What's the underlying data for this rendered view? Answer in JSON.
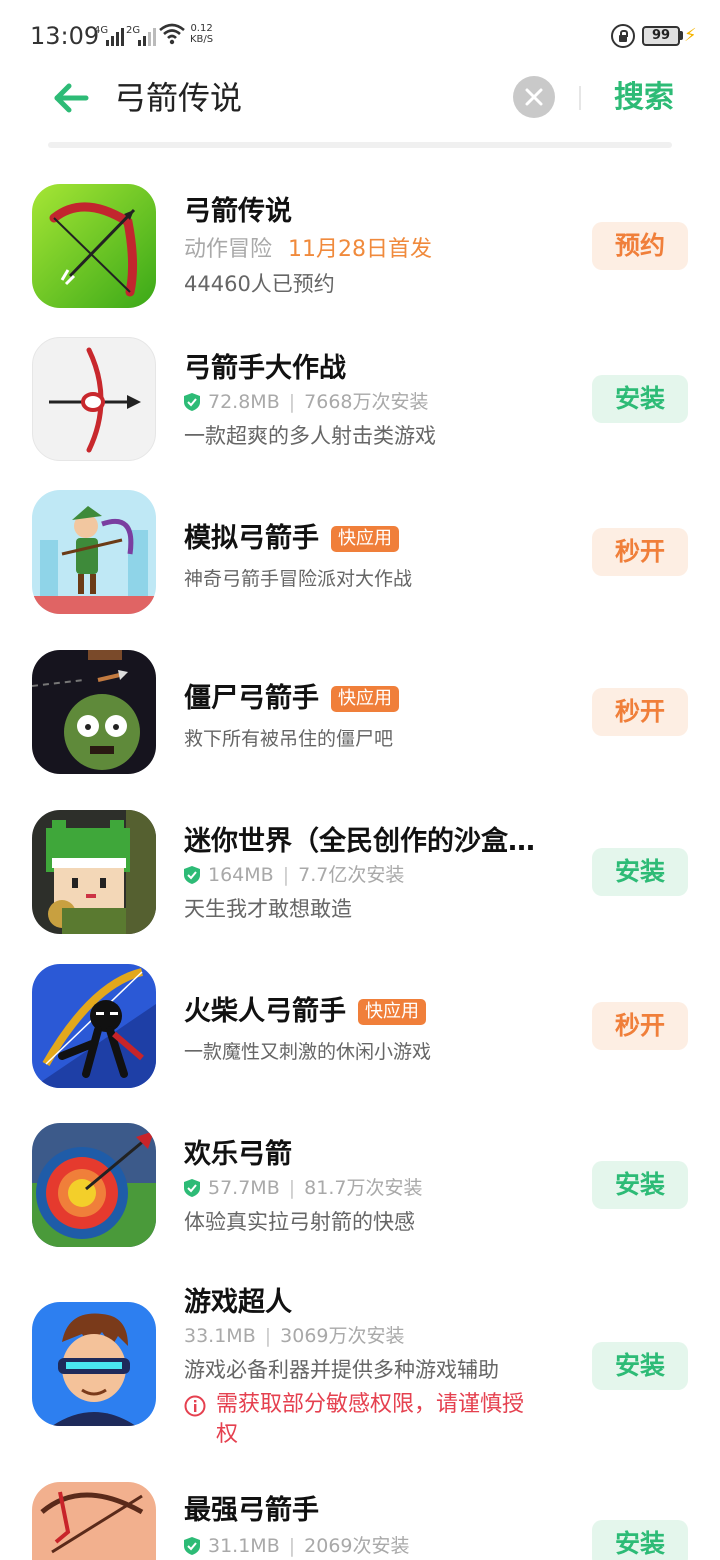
{
  "status_bar": {
    "time": "13:09",
    "sim1_label": "4G",
    "sim2_label": "2G",
    "net_speed_value": "0.12",
    "net_speed_unit": "KB/S",
    "battery": "99",
    "colors": {
      "text": "#333333",
      "charging": "#f5b400"
    }
  },
  "search": {
    "query": "弓箭传说",
    "search_button_label": "搜索",
    "icons": {
      "back": "arrow-left-icon",
      "clear": "close-circle-icon"
    },
    "colors": {
      "accent": "#2dbb76"
    }
  },
  "results": [
    {
      "name": "弓箭传说",
      "genre": "动作冒险",
      "release": "11月28日首发",
      "desc": "44460人已预约",
      "button": "预约",
      "button_style": "orange"
    },
    {
      "name": "弓箭手大作战",
      "size": "72.8MB",
      "installs": "7668万次安装",
      "desc": "一款超爽的多人射击类游戏",
      "button": "安装",
      "button_style": "green"
    },
    {
      "name": "模拟弓箭手",
      "badge": "快应用",
      "desc": "神奇弓箭手冒险派对大作战",
      "button": "秒开",
      "button_style": "orange"
    },
    {
      "name": "僵尸弓箭手",
      "badge": "快应用",
      "desc": "救下所有被吊住的僵尸吧",
      "button": "秒开",
      "button_style": "orange"
    },
    {
      "name": "迷你世界（全民创作的沙盒…",
      "size": "164MB",
      "installs": "7.7亿次安装",
      "desc": "天生我才敢想敢造",
      "button": "安装",
      "button_style": "green"
    },
    {
      "name": "火柴人弓箭手",
      "badge": "快应用",
      "desc": "一款魔性又刺激的休闲小游戏",
      "button": "秒开",
      "button_style": "orange"
    },
    {
      "name": "欢乐弓箭",
      "size": "57.7MB",
      "installs": "81.7万次安装",
      "desc": "体验真实拉弓射箭的快感",
      "button": "安装",
      "button_style": "green"
    },
    {
      "name": "游戏超人",
      "size": "33.1MB",
      "installs": "3069万次安装",
      "desc": "游戏必备利器并提供多种游戏辅助",
      "warning": "需获取部分敏感权限，请谨慎授权",
      "button": "安装",
      "button_style": "green"
    },
    {
      "name": "最强弓箭手",
      "size": "31.1MB",
      "installs": "2069次安装",
      "button": "安装",
      "button_style": "green"
    }
  ],
  "colors": {
    "install_green": "#2dbb76",
    "install_green_bg": "#e4f6ec",
    "quick_orange": "#f07f3a",
    "quick_orange_bg": "#fdeee3",
    "warning_red": "#e5404f"
  }
}
